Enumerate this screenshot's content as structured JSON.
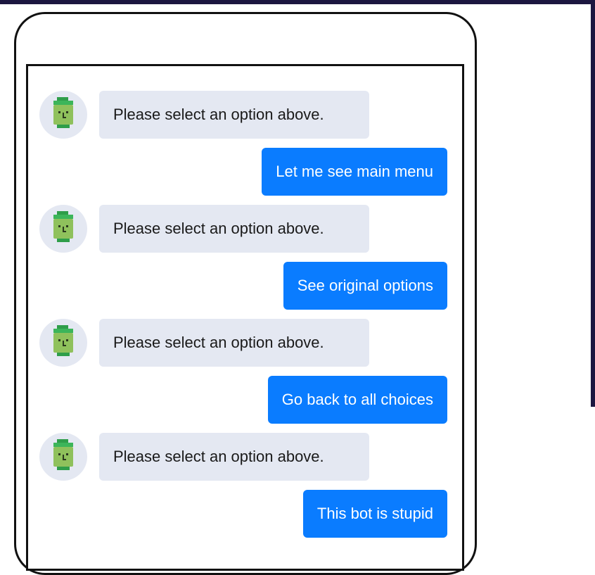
{
  "colors": {
    "user_bubble": "#0a7cff",
    "bot_bubble": "#e4e8f2",
    "frame_background": "#1c1640"
  },
  "chat": {
    "bot_avatar_icon": "robot-face-icon",
    "messages": [
      {
        "sender": "bot",
        "text": "Please select an option above."
      },
      {
        "sender": "user",
        "text": "Let me see main menu"
      },
      {
        "sender": "bot",
        "text": "Please select an option above."
      },
      {
        "sender": "user",
        "text": "See original options"
      },
      {
        "sender": "bot",
        "text": "Please select an option above."
      },
      {
        "sender": "user",
        "text": "Go back to all choices"
      },
      {
        "sender": "bot",
        "text": "Please select an option above."
      },
      {
        "sender": "user",
        "text": "This bot is stupid"
      }
    ]
  }
}
